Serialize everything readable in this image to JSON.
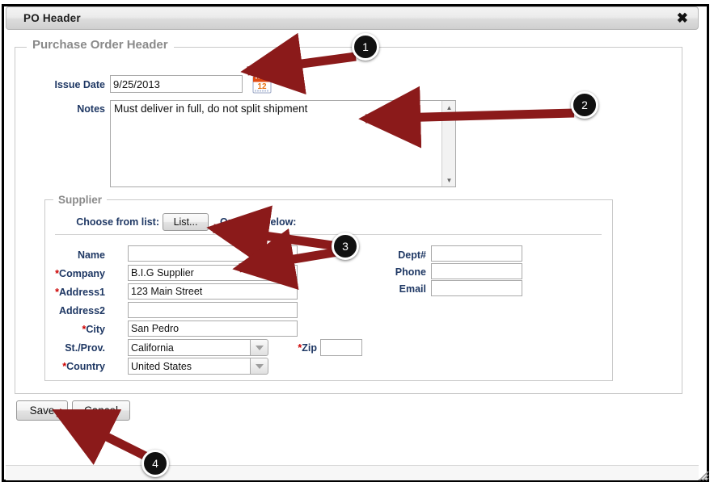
{
  "window": {
    "title": "PO Header",
    "close_icon": "close-x-icon",
    "resize_grip_icon": "resize-grip-icon"
  },
  "po_header": {
    "legend": "Purchase Order Header",
    "issue_date": {
      "label": "Issue Date",
      "value": "9/25/2013",
      "calendar_icon": "calendar-icon",
      "calendar_day": "12"
    },
    "notes": {
      "label": "Notes",
      "value": "Must deliver in full, do not split shipment",
      "scroll_up_icon": "scroll-up-arrow-icon",
      "scroll_down_icon": "scroll-down-arrow-icon"
    }
  },
  "supplier": {
    "legend": "Supplier",
    "choose_label": "Choose from list:",
    "list_button": "List...",
    "or_label": "Or, enter below:",
    "left_fields": [
      {
        "label": "Name",
        "required": false,
        "value": "",
        "type": "text"
      },
      {
        "label": "Company",
        "required": true,
        "value": "B.I.G Supplier",
        "type": "text"
      },
      {
        "label": "Address1",
        "required": true,
        "value": "123 Main Street",
        "type": "text"
      },
      {
        "label": "Address2",
        "required": false,
        "value": "",
        "type": "text"
      },
      {
        "label": "City",
        "required": true,
        "value": "San Pedro",
        "type": "text"
      },
      {
        "label": "St./Prov.",
        "required": false,
        "value": "California",
        "type": "select"
      },
      {
        "label": "Country",
        "required": true,
        "value": "United States",
        "type": "select"
      }
    ],
    "right_fields": [
      {
        "label": "Dept#",
        "required": false,
        "value": ""
      },
      {
        "label": "Phone",
        "required": false,
        "value": ""
      },
      {
        "label": "Email",
        "required": false,
        "value": ""
      }
    ],
    "zip": {
      "label": "Zip",
      "required": true,
      "value": ""
    }
  },
  "footer": {
    "save_label": "Save",
    "cancel_label": "Cancel"
  },
  "annotations": {
    "arrow_color": "#8B1A1A",
    "badge_bg": "#111111",
    "badge_fg": "#FFFFFF",
    "items": [
      {
        "number": "1",
        "target": "issue-date-field"
      },
      {
        "number": "2",
        "target": "notes-field"
      },
      {
        "number": "3",
        "target": "supplier-entry-fields"
      },
      {
        "number": "4",
        "target": "save-button"
      }
    ]
  }
}
